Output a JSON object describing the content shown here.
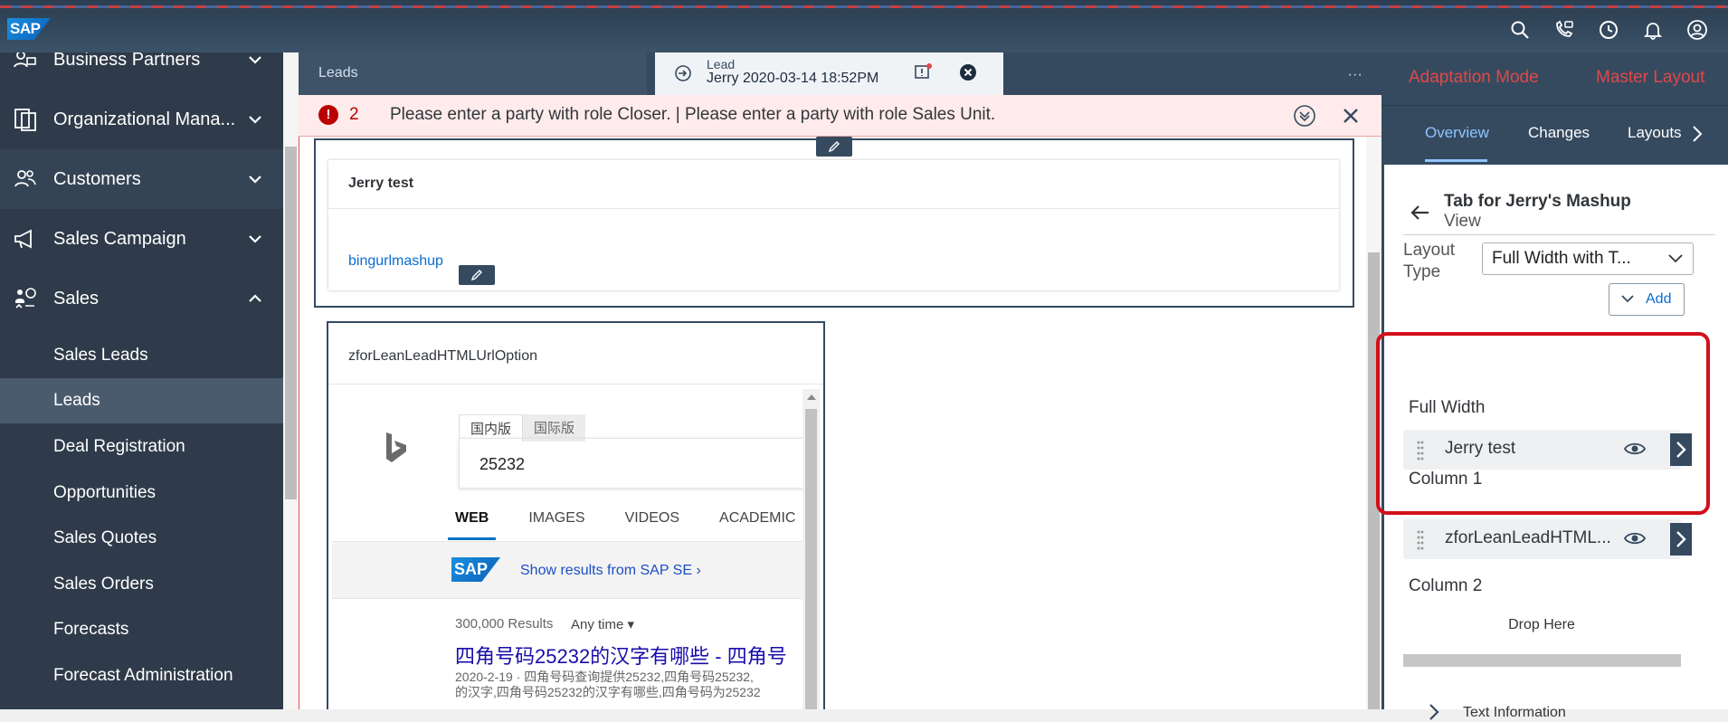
{
  "shell": {
    "logo": "SAP",
    "icons": [
      "search-icon",
      "phone-chat-icon",
      "clock-icon",
      "bell-icon",
      "user-icon"
    ]
  },
  "nav": {
    "items": [
      {
        "label": "Business Partners"
      },
      {
        "label": "Organizational Mana..."
      },
      {
        "label": "Customers"
      },
      {
        "label": "Sales Campaign"
      },
      {
        "label": "Sales"
      }
    ],
    "sub_items": [
      {
        "label": "Sales Leads"
      },
      {
        "label": "Leads"
      },
      {
        "label": "Deal Registration"
      },
      {
        "label": "Opportunities"
      },
      {
        "label": "Sales Quotes"
      },
      {
        "label": "Sales Orders"
      },
      {
        "label": "Forecasts"
      },
      {
        "label": "Forecast Administration"
      }
    ]
  },
  "tabs": {
    "leads_label": "Leads",
    "lead_type": "Lead",
    "lead_title": "Jerry 2020-03-14 18:52PM",
    "overflow": "∙∙∙"
  },
  "error": {
    "count": "2",
    "message": "Please enter a party with role Closer. | Please enter a party with role Sales Unit."
  },
  "full_card": {
    "title": "Jerry test",
    "link": "bingurlmashup"
  },
  "col_card": {
    "title": "zforLeanLeadHTMLUrlOption"
  },
  "bing": {
    "tab_domestic": "国内版",
    "tab_intl": "国际版",
    "query": "25232",
    "nav": [
      "WEB",
      "IMAGES",
      "VIDEOS",
      "ACADEMIC"
    ],
    "sap_logo": "SAP",
    "sap_link": "Show results from SAP SE",
    "results_count": "300,000 Results",
    "any_time": "Any time",
    "result_title": "四角号码25232的汉字有哪些 - 四角号",
    "result_snippet_1": "2020-2-19 · 四角号码查询提供25232,四角号码25232,",
    "result_snippet_2": "的汉字,四角号码25232的汉字有哪些,四角号码为25232"
  },
  "panel": {
    "mode": "Adaptation Mode",
    "master": "Master Layout",
    "tabs": [
      "Overview",
      "Changes",
      "Layouts"
    ],
    "title": "Tab for Jerry's Mashup",
    "subtitle": "View",
    "layout_type_label": "Layout Type",
    "layout_type_value": "Full Width with T...",
    "add_label": "Add",
    "sections": {
      "full_width": "Full Width",
      "column1": "Column 1",
      "column2": "Column 2"
    },
    "rows": {
      "full_width_item": "Jerry test",
      "column1_item": "zforLeanLeadHTML..."
    },
    "drop_here": "Drop Here",
    "text_information": "Text Information"
  }
}
